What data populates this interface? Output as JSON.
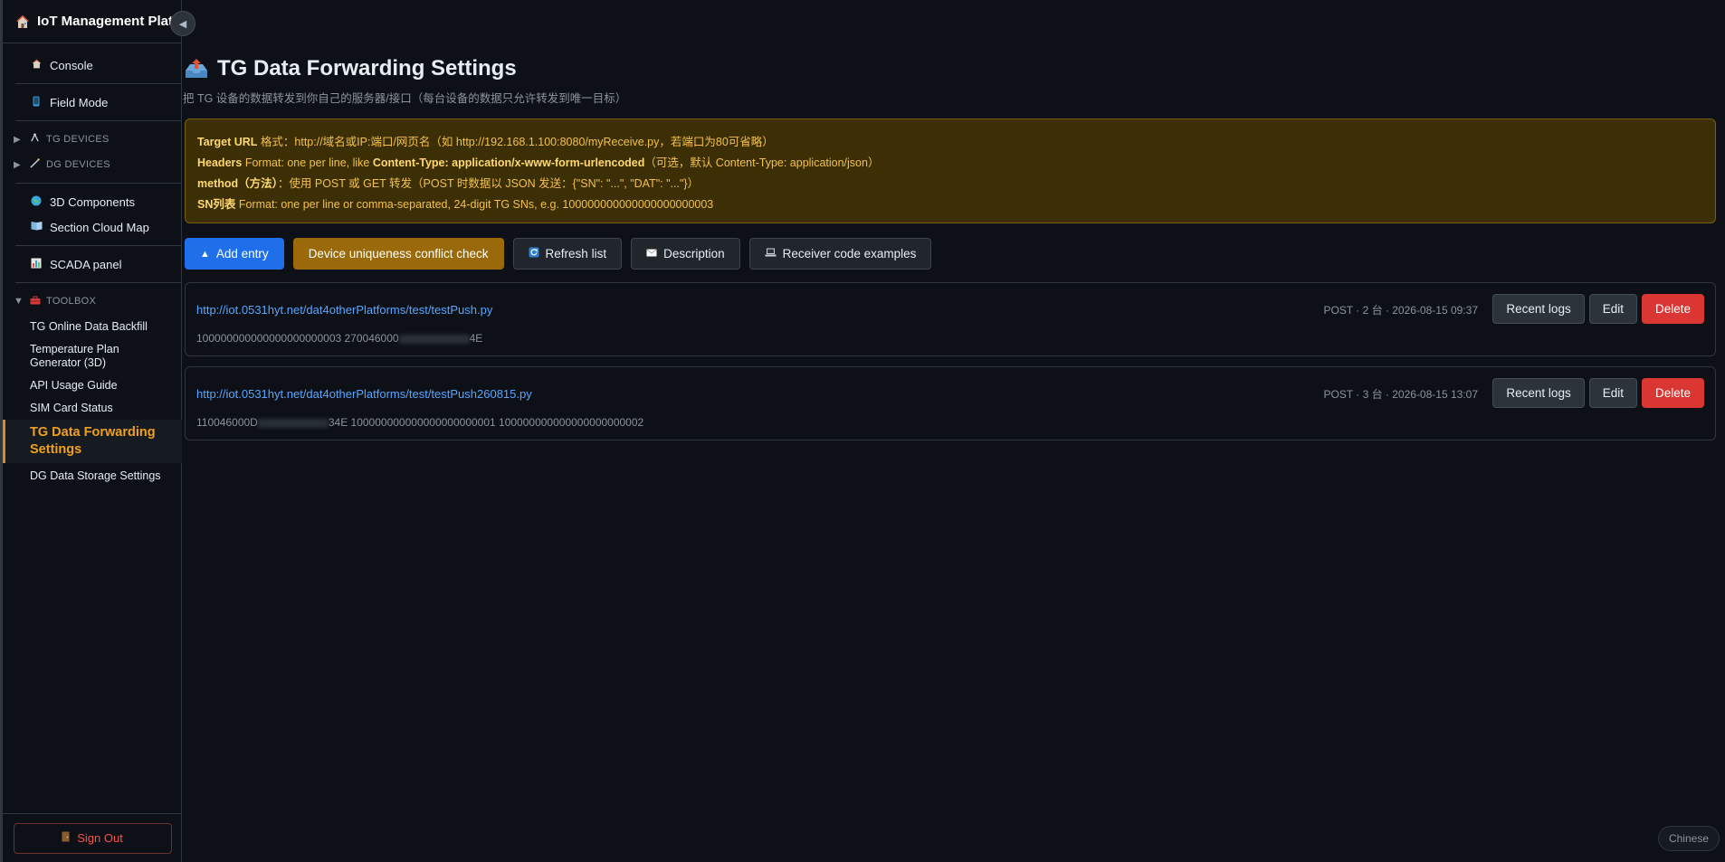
{
  "app": {
    "title": "IoT Management Plat",
    "collapse_icon": "◀"
  },
  "sidebar": {
    "top_items": [
      {
        "label": "Console",
        "icon": "home-icon"
      },
      {
        "label": "Field Mode",
        "icon": "phone-icon"
      }
    ],
    "groups": [
      {
        "label": "TG DEVICES",
        "icon": "antenna-icon"
      },
      {
        "label": "DG DEVICES",
        "icon": "wand-icon"
      }
    ],
    "mid_items": [
      {
        "label": "3D Components",
        "icon": "globe-icon"
      },
      {
        "label": "Section Cloud Map",
        "icon": "book-icon"
      },
      {
        "label": "SCADA panel",
        "icon": "chart-icon"
      }
    ],
    "toolbox": {
      "label": "TOOLBOX",
      "icon": "toolbox-icon",
      "items": [
        {
          "label": "TG Online Data Backfill"
        },
        {
          "label": "Temperature Plan Generator (3D)"
        },
        {
          "label": "API Usage Guide"
        },
        {
          "label": "SIM Card Status"
        },
        {
          "label": "TG Data Forwarding Settings",
          "active": true
        },
        {
          "label": "DG Data Storage Settings"
        }
      ]
    },
    "sign_out": "Sign Out"
  },
  "main": {
    "title": "TG Data Forwarding Settings",
    "subtitle": "把 TG 设备的数据转发到你自己的服务器/接口（每台设备的数据只允许转发到唯一目标）",
    "notice": {
      "line1_key": "Target URL",
      "line1_text": " 格式：http://域名或IP:端口/网页名（如 http://192.168.1.100:8080/myReceive.py，若端口为80可省略）",
      "line2_key": "Headers",
      "line2_text1": " Format: one per line, like ",
      "line2_strong": "Content-Type: application/x-www-form-urlencoded",
      "line2_text2": "（可选，默认 Content-Type: application/json）",
      "line3_key": "method（方法）",
      "line3_text": "：使用 POST 或 GET 转发（POST 时数据以 JSON 发送：{\"SN\": \"...\", \"DAT\": \"...\"}）",
      "line4_key": "SN列表",
      "line4_text": " Format: one per line or comma-separated, 24-digit TG SNs, e.g. 100000000000000000000003"
    },
    "toolbar": {
      "add": "Add entry",
      "conflict": "Device uniqueness conflict check",
      "refresh": "Refresh list",
      "description": "Description",
      "examples": "Receiver code examples"
    },
    "entries": [
      {
        "url": "http://iot.0531hyt.net/dat4otherPlatforms/test/testPush.py",
        "sns_a": "100000000000000000000003 270046000",
        "sns_b": "4E",
        "meta": "POST · 2 台 · 2026-08-15 09:37"
      },
      {
        "url": "http://iot.0531hyt.net/dat4otherPlatforms/test/testPush260815.py",
        "sns_a": "110046000D",
        "sns_b": "34E 100000000000000000000001 100000000000000000000002",
        "meta": "POST · 3 台 · 2026-08-15 13:07"
      }
    ],
    "entry_actions": {
      "logs": "Recent logs",
      "edit": "Edit",
      "delete": "Delete"
    }
  },
  "language_toggle": "Chinese",
  "colors": {
    "accent_blue": "#1f6feb",
    "active_orange": "#f0a020",
    "danger_red": "#da3633",
    "notice_bg": "#3d2f05"
  }
}
